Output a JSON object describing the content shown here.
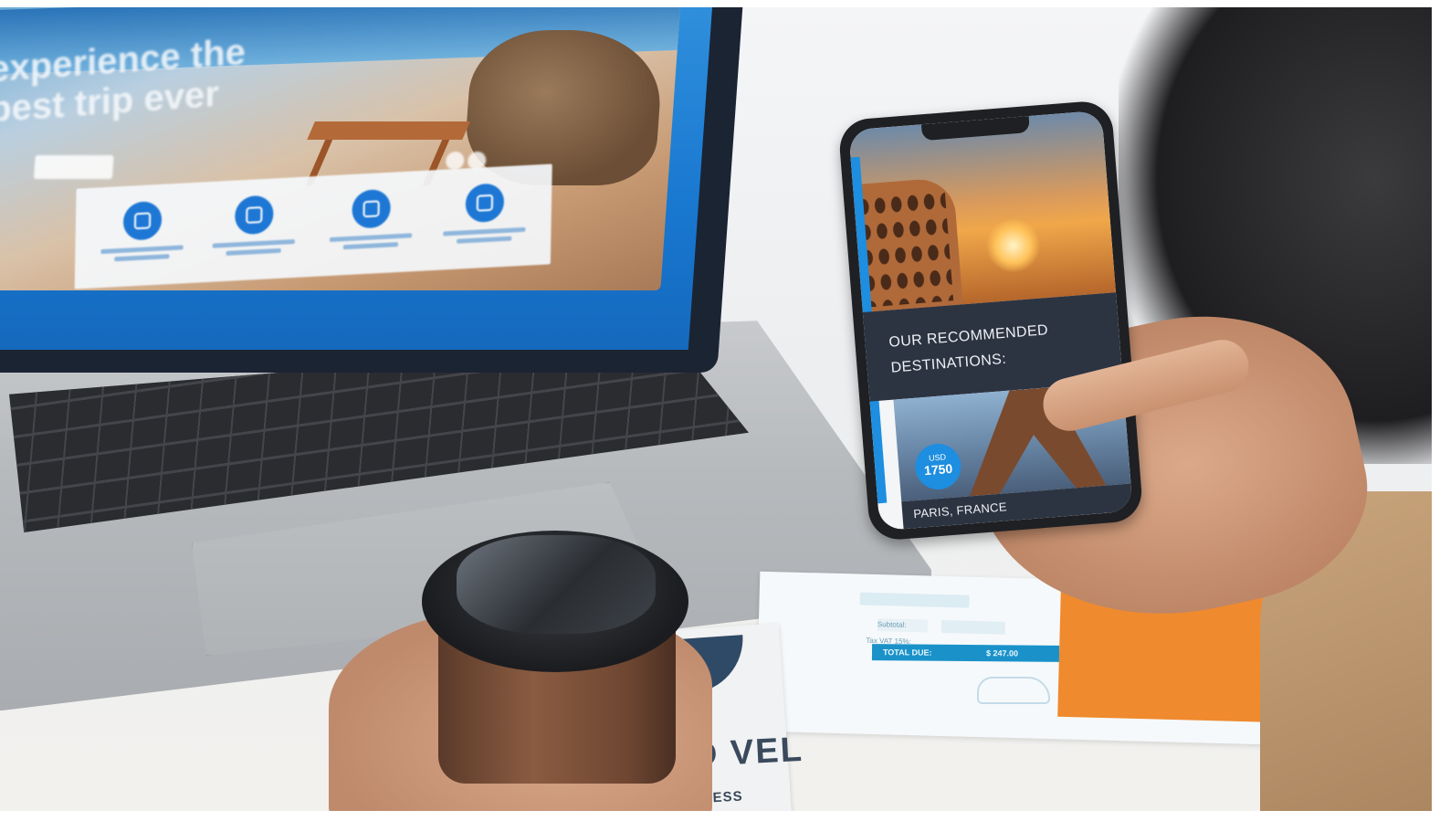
{
  "laptop": {
    "hero_title": "experience the best trip ever",
    "features_count": 4
  },
  "phone": {
    "heading": "OUR RECOMMENDED DESTINATIONS:",
    "destination": {
      "name": "PARIS, FRANCE",
      "currency": "USD",
      "price": "1750"
    }
  },
  "invoice": {
    "subtotal_label": "Subtotal:",
    "tax_label": "Tax VAT 15%:",
    "total_label": "TOTAL DUE:",
    "total_amount": "$ 247.00"
  },
  "brochure": {
    "big_text": "D VEL",
    "tagline": "HAPPINESS"
  },
  "colors": {
    "phone_accent": "#1d8ee0",
    "phone_panel": "#2c3442",
    "invoice_total_bar": "#1a92c9",
    "orange_paper": "#ef8a2e"
  }
}
